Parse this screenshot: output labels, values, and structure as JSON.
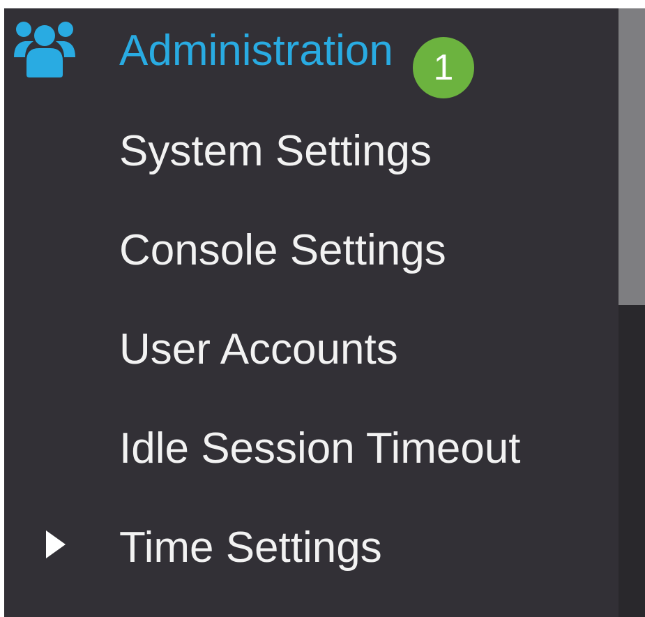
{
  "sidebar": {
    "header": {
      "label": "Administration",
      "icon": "users-icon",
      "accent_color": "#29abe2",
      "badge": "1",
      "badge_color": "#6cb33f"
    },
    "items": [
      {
        "label": "System Settings"
      },
      {
        "label": "Console Settings"
      },
      {
        "label": "User Accounts"
      },
      {
        "label": "Idle Session Timeout"
      },
      {
        "label": "Time Settings",
        "icon": "caret-right-icon",
        "expandable": true
      }
    ]
  }
}
